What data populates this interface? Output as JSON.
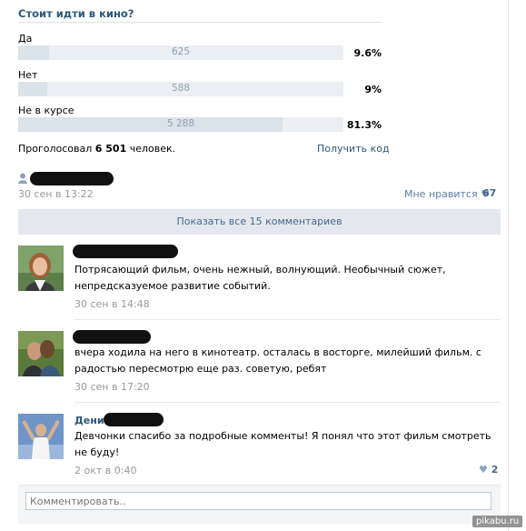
{
  "poll": {
    "question": "Стоит идти в кино?",
    "options": [
      {
        "label": "Да",
        "count": "625",
        "percent": "9.6%",
        "fraction": 0.096
      },
      {
        "label": "Нет",
        "count": "588",
        "percent": "9%",
        "fraction": 0.09
      },
      {
        "label": "Не в курсе",
        "count": "5 288",
        "percent": "81.3%",
        "fraction": 0.813
      }
    ],
    "voted_prefix": "Проголосовал",
    "voted_count": "6 501",
    "voted_suffix": "человек.",
    "get_code": "Получить код"
  },
  "post": {
    "date": "30 сен в 13:22",
    "like_label": "Мне нравится",
    "like_count": "67"
  },
  "show_all": "Показать все 15 комментариев",
  "comments": [
    {
      "text": "Потрясающий фильм, очень нежный, волнующий. Необычный сюжет, непредсказуемое развитие событий.",
      "date": "30 сен в 14:48"
    },
    {
      "text": "вчера ходила на него в кинотеатр. осталась в восторге, милейший фильм. с радостью пересмотрю еще раз. советую, ребят",
      "date": "30 сен в 17:20"
    },
    {
      "name": "Денис",
      "text": "Девчонки спасибо за подробные комменты! Я понял что этот фильм смотреть не буду!",
      "date": "2 окт в 0:40",
      "likes": "2"
    }
  ],
  "comment_input": {
    "placeholder": "Комментировать.."
  },
  "watermark": "pikabu.ru",
  "colors": {
    "link": "#2b587a",
    "bar": "#dae2ea",
    "track": "#ebeef2",
    "button_bg": "#e4e8ee"
  }
}
